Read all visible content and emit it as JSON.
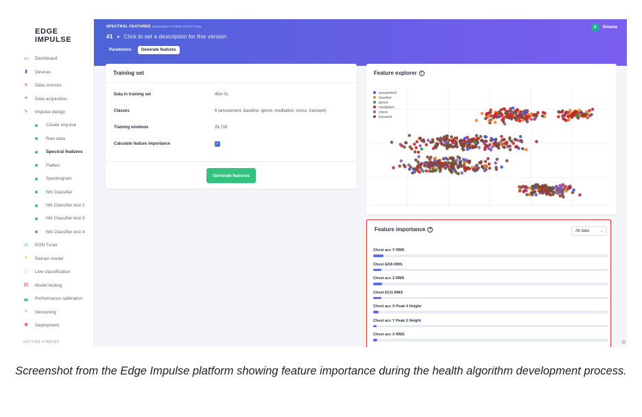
{
  "app": {
    "logo_text": "EDGE IMPULSE",
    "logo_colors": [
      "#f6b632",
      "#35c27e",
      "#4c6ad8"
    ]
  },
  "sidebar": {
    "items": [
      {
        "label": "Dashboard",
        "icon": "monitor-icon",
        "level": "top",
        "color": "#4c6ad8"
      },
      {
        "label": "Devices",
        "icon": "devices-icon",
        "level": "top",
        "color": "#4c6ad8"
      },
      {
        "label": "Data sources",
        "icon": "data-sources-icon",
        "level": "top",
        "color": "#e5484d"
      },
      {
        "label": "Data acquisition",
        "icon": "database-icon",
        "level": "top",
        "color": "#6b3fa0"
      },
      {
        "label": "Impulse design",
        "icon": "pulse-icon",
        "level": "top",
        "color": "#e5484d"
      },
      {
        "label": "Create impulse",
        "level": "sub"
      },
      {
        "label": "Raw data",
        "level": "sub"
      },
      {
        "label": "Spectral features",
        "level": "sub",
        "active": true
      },
      {
        "label": "Flatten",
        "level": "sub"
      },
      {
        "label": "Spectrogram",
        "level": "sub"
      },
      {
        "label": "NN Classifier",
        "level": "sub"
      },
      {
        "label": "NN Classifier test 2",
        "level": "sub"
      },
      {
        "label": "NN Classifier test 3",
        "level": "sub"
      },
      {
        "label": "NN Classifier test 4",
        "level": "sub",
        "muted": true
      },
      {
        "label": "EON Tuner",
        "icon": "tuner-icon",
        "level": "top",
        "color": "#35c27e"
      },
      {
        "label": "Retrain model",
        "icon": "retrain-icon",
        "level": "top",
        "color": "#f6b632"
      },
      {
        "label": "Live classification",
        "icon": "live-icon",
        "level": "top",
        "color": "#35c27e"
      },
      {
        "label": "Model testing",
        "icon": "clipboard-icon",
        "level": "top",
        "color": "#e5484d"
      },
      {
        "label": "Performance calibration",
        "icon": "chart-icon",
        "level": "top",
        "color": "#35c27e"
      },
      {
        "label": "Versioning",
        "icon": "branch-icon",
        "level": "top",
        "color": "#6b3fa0"
      },
      {
        "label": "Deployment",
        "icon": "gift-icon",
        "level": "top",
        "color": "#e5484d"
      }
    ],
    "footer": "GETTING STARTED"
  },
  "header": {
    "breadcrumb": "SPECTRAL FEATURES",
    "breadcrumb_sub": "(WEARABLE STRESS DETECTION)",
    "version_number": "#1",
    "version_desc": "Click to set a description for this version",
    "tabs": [
      {
        "label": "Parameters",
        "active": false
      },
      {
        "label": "Generate features",
        "active": true
      }
    ],
    "user_initial": "S",
    "user_name": "Sheena"
  },
  "training_set": {
    "title": "Training set",
    "rows": [
      {
        "key": "Data in training set",
        "value": "45m 0s"
      },
      {
        "key": "Classes",
        "value": "6 (amusement, baseline, ignore, meditation, stress, transient)"
      },
      {
        "key": "Training windows",
        "value": "26,718"
      },
      {
        "key": "Calculate feature importance",
        "checked": true
      }
    ],
    "button": "Generate features"
  },
  "feature_explorer": {
    "title": "Feature explorer",
    "info_icon": "info-icon",
    "legend": [
      {
        "name": "amusement",
        "color": "#3b5bd6"
      },
      {
        "name": "baseline",
        "color": "#e8862b"
      },
      {
        "name": "ignore",
        "color": "#2e9a4a"
      },
      {
        "name": "meditation",
        "color": "#c62828"
      },
      {
        "name": "stress",
        "color": "#8e5bb5"
      },
      {
        "name": "transient",
        "color": "#7a4b3a"
      }
    ]
  },
  "feature_importance": {
    "title": "Feature importance",
    "filter": "All data",
    "features": [
      {
        "name": "Chest acc Y RMS",
        "importance": 0.05
      },
      {
        "name": "Chest EDA RMS",
        "importance": 0.04
      },
      {
        "name": "Chest acc Z RMS",
        "importance": 0.045
      },
      {
        "name": "Chest ECG RMS",
        "importance": 0.04
      },
      {
        "name": "Chest acc X Peak 4 Height",
        "importance": 0.028
      },
      {
        "name": "Chest acc Y Peak 2 Height",
        "importance": 0.018
      },
      {
        "name": "Chest acc X RMS",
        "importance": 0.02
      }
    ]
  },
  "caption": "Screenshot from the Edge Impulse platform showing feature importance during the health algorithm development process."
}
